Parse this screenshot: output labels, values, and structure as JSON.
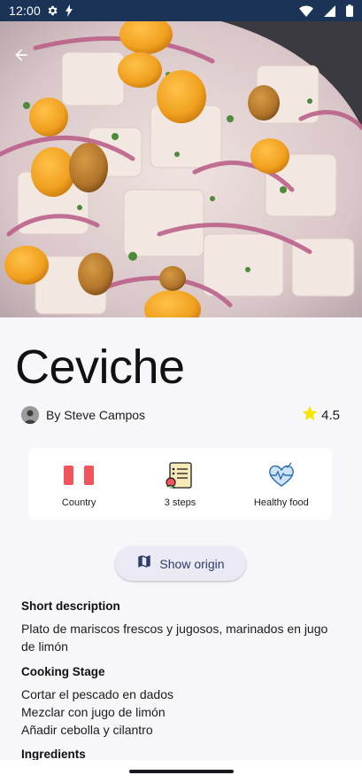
{
  "status_bar": {
    "time": "12:00"
  },
  "recipe": {
    "title": "Ceviche",
    "author": "By Steve Campos",
    "rating": "4.5"
  },
  "info_card": {
    "country_label": "Country",
    "steps_label": "3 steps",
    "health_label": "Healthy food"
  },
  "origin_button": {
    "label": "Show origin"
  },
  "sections": {
    "short_description_title": "Short description",
    "short_description_text": "Plato de mariscos frescos y jugosos, marinados en jugo de limón",
    "cooking_stage_title": "Cooking Stage",
    "cooking_steps": [
      "Cortar el pescado en dados",
      "Mezclar con jugo de limón",
      "Añadir cebolla y cilantro"
    ],
    "ingredients_title": "Ingredients"
  },
  "icons": {
    "status_settings": "gear-icon",
    "status_bolt": "bolt-icon",
    "status_wifi": "wifi-icon",
    "status_signal": "signal-icon",
    "status_battery": "battery-icon",
    "back": "arrow-left-icon",
    "rating": "star-icon",
    "country": "peru-flag-icon",
    "steps": "recipe-list-icon",
    "health": "heart-pulse-icon",
    "origin": "map-icon"
  },
  "colors": {
    "status_bar": "#1b3357",
    "star": "#f5e600",
    "flag_red": "#f2545b",
    "button_bg": "#ebe9f3",
    "button_text": "#2d3e6b"
  }
}
